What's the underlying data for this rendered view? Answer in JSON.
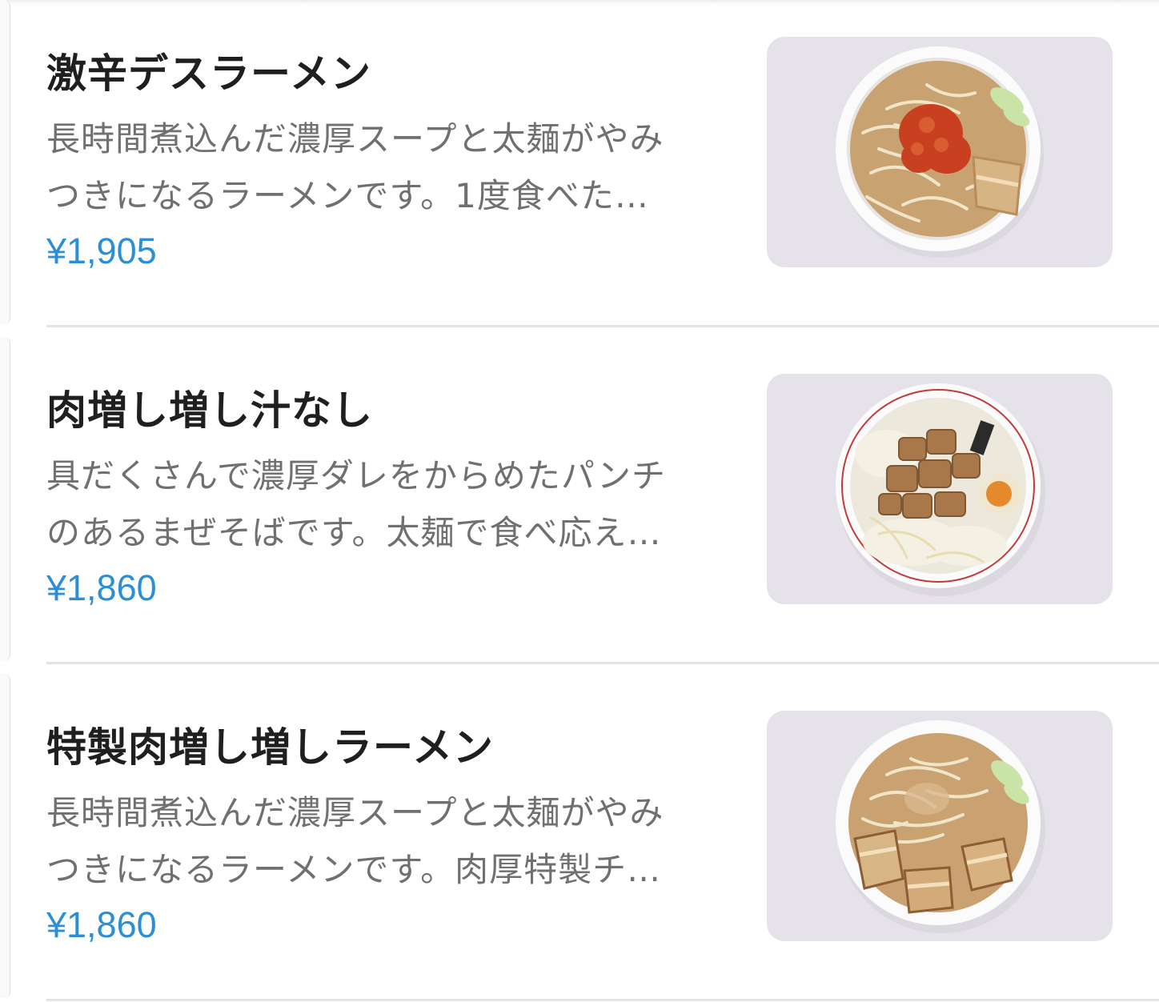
{
  "menu": {
    "items": [
      {
        "name": "激辛デスラーメン",
        "description_lines": [
          "長時間煮込んだ濃厚スープと太麺がやみ",
          "つきになるラーメンです。1度食べた…"
        ],
        "price": "¥1,905",
        "photo": "spicy-ramen-photo"
      },
      {
        "name": "肉増し増し汁なし",
        "description_lines": [
          "具だくさんで濃厚ダレをからめたパンチ",
          "のあるまぜそばです。太麺で食べ応え…"
        ],
        "price": "¥1,860",
        "photo": "soupless-mazesoba-photo"
      },
      {
        "name": "特製肉増し増しラーメン",
        "description_lines": [
          "長時間煮込んだ濃厚スープと太麺がやみ",
          "つきになるラーメンです。肉厚特製チ…"
        ],
        "price": "¥1,860",
        "photo": "special-chashu-ramen-photo"
      }
    ]
  },
  "colors": {
    "price": "#2c8fd6",
    "title": "#1f1f1f",
    "description": "#707070",
    "photo_background": "#e5e2ea",
    "divider": "#e4e4e4"
  }
}
